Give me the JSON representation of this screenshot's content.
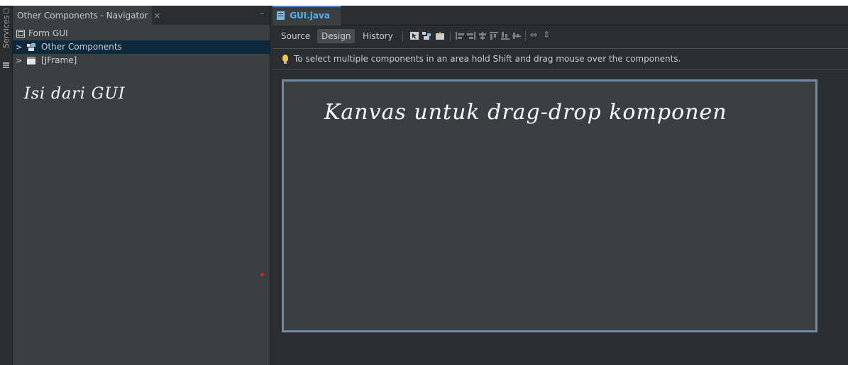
{
  "navigator": {
    "tab_title": "Other Components - Navigator",
    "close_glyph": "×",
    "minimize_glyph": "–",
    "tree": [
      {
        "label": "Form GUI",
        "icon": "form-icon"
      },
      {
        "label": "Other Components",
        "icon": "components-icon",
        "selected": true
      },
      {
        "label": "[JFrame]",
        "icon": "jframe-icon"
      }
    ]
  },
  "side_strip": {
    "label": "Services"
  },
  "annotations": {
    "navigator_note": "Isi dari GUI",
    "canvas_note": "Kanvas untuk drag-drop komponen"
  },
  "editor": {
    "tab_title": "GUI.java",
    "close_glyph": "×",
    "toolbar": {
      "source": "Source",
      "design": "Design",
      "history": "History",
      "active": "Design"
    },
    "hint": "To select multiple components in an area hold Shift and drag mouse over the components."
  },
  "colors": {
    "background": "#2b2d30",
    "panel": "#3c3f41",
    "selection": "#0d293e",
    "tab_accent": "#4fb3f0",
    "canvas_border": "#6e8aa8",
    "hint_bulb": "#f3c94b"
  }
}
